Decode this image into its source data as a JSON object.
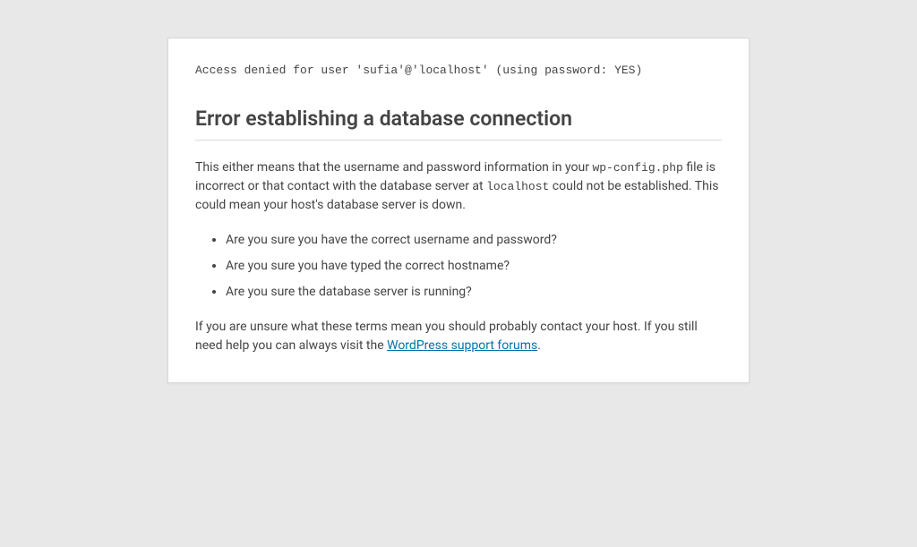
{
  "error": {
    "db_message": "Access denied for user 'sufia'@'localhost' (using password: YES)",
    "heading": "Error establishing a database connection",
    "intro": {
      "part1": "This either means that the username and password information in your ",
      "code1": "wp-config.php",
      "part2": " file is incorrect or that contact with the database server at ",
      "code2": "localhost",
      "part3": " could not be established. This could mean your host's database server is down."
    },
    "checks": [
      "Are you sure you have the correct username and password?",
      "Are you sure you have typed the correct hostname?",
      "Are you sure the database server is running?"
    ],
    "outro": {
      "part1": "If you are unsure what these terms mean you should probably contact your host. If you still need help you can always visit the ",
      "link_text": "WordPress support forums",
      "part2": "."
    }
  }
}
